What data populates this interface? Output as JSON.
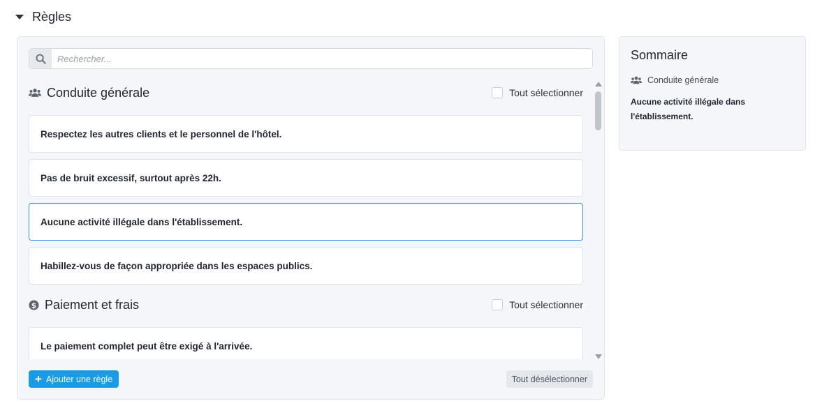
{
  "section": {
    "title": "Règles"
  },
  "search": {
    "placeholder": "Rechercher...",
    "value": ""
  },
  "groups": [
    {
      "title": "Conduite générale",
      "icon": "users-icon",
      "select_all": "Tout sélectionner",
      "rules": [
        "Respectez les autres clients et le personnel de l'hôtel.",
        "Pas de bruit excessif, surtout après 22h.",
        "Aucune activité illégale dans l'établissement.",
        "Habillez-vous de façon appropriée dans les espaces publics."
      ]
    },
    {
      "title": "Paiement et frais",
      "icon": "dollar-circle-icon",
      "select_all": "Tout sélectionner",
      "rules": [
        "Le paiement complet peut être exigé à l'arrivée."
      ]
    }
  ],
  "actions": {
    "add_rule": "Ajouter une règle",
    "deselect_all": "Tout désélectionner"
  },
  "summary": {
    "title": "Sommaire",
    "category": "Conduite générale",
    "items": [
      "Aucune activité illégale dans l'établissement."
    ]
  },
  "colors": {
    "accent": "#1a9be6",
    "selected_border": "#3b8fdb",
    "panel_bg": "#f4f6f9"
  }
}
